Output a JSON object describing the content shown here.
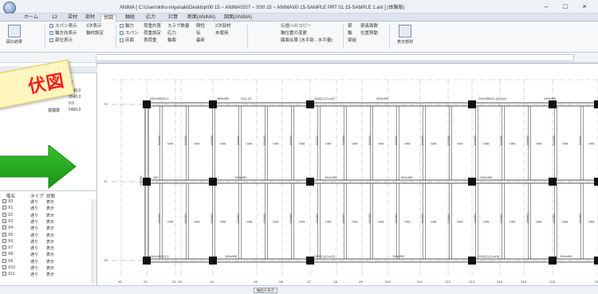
{
  "window": {
    "title": "ANIMA [ C:\\Users\\kiho-miyanaki\\Desktop\\00 15 ~ ANIMA\\SS7 ~ SS0 15 ~ ANIMA\\00 15-SAMPLE PRT 01 15-SAMPLE 1.anl ] (体験版)",
    "minimize": "–",
    "maximize": "□",
    "close": "×"
  },
  "menu_tabs": [
    {
      "label": "ホーム"
    },
    {
      "label": "13"
    },
    {
      "label": "梁材"
    },
    {
      "label": "部材"
    },
    {
      "label": "伏図"
    },
    {
      "label": "軸組"
    },
    {
      "label": "応力"
    },
    {
      "label": "計算"
    },
    {
      "label": "断面(ANIMA)"
    },
    {
      "label": "図面(ANIMA)"
    }
  ],
  "ribbon": {
    "group1_button": "図の結果",
    "col1": [
      "スパン表示",
      "軸方向表示",
      "部位表示"
    ],
    "col2": [
      "2次表示",
      "軸材設定"
    ],
    "col3": [
      "軸力",
      "スパン",
      "床面"
    ],
    "col4": [
      "荷重計算",
      "荷重設定",
      "実荷重"
    ],
    "col5": [
      "スラブ数量",
      "応力",
      "軸面"
    ],
    "col6": [
      "剛性",
      "伝",
      "最新"
    ],
    "col7": [
      "2次部材",
      "未使用",
      ""
    ],
    "col8": [
      "伝播へのコピー",
      "軸位置の変更",
      "図面合算 (水平部 - 水平量)"
    ],
    "col9": [
      "梁",
      "軸",
      "梁組"
    ],
    "col10": [
      "梁長面数",
      "位置移動",
      ""
    ],
    "big_button2": "表示部材"
  },
  "left_panel": {
    "rows": [
      {
        "text": "1F"
      },
      {
        "text": "6540.0"
      },
      {
        "text": "5540.0"
      },
      {
        "text": "0.0"
      },
      {
        "text": "基礎層"
      },
      {
        "text": "5400.0"
      }
    ],
    "columns": [
      "階名",
      "タイプ",
      "状態"
    ],
    "list": [
      {
        "name": "X0",
        "type": "通り",
        "state": "表示"
      },
      {
        "name": "X1",
        "type": "通り",
        "state": "表示"
      },
      {
        "name": "X2",
        "type": "通り",
        "state": "表示"
      },
      {
        "name": "X3",
        "type": "通り",
        "state": "表示"
      },
      {
        "name": "X4",
        "type": "通り",
        "state": "表示"
      },
      {
        "name": "X5",
        "type": "通り",
        "state": "表示"
      },
      {
        "name": "X6",
        "type": "通り",
        "state": "表示"
      },
      {
        "name": "X7",
        "type": "通り",
        "state": "表示"
      },
      {
        "name": "X8",
        "type": "通り",
        "state": "表示"
      },
      {
        "name": "X9",
        "type": "通り",
        "state": "表示"
      },
      {
        "name": "X10",
        "type": "通り",
        "state": "表示"
      },
      {
        "name": "X11",
        "type": "通り",
        "state": "表示"
      }
    ]
  },
  "stamp": {
    "text": "伏図"
  },
  "plan": {
    "y_axis": [
      {
        "label": "Y2"
      },
      {
        "label": "Y1"
      },
      {
        "label": "Y0"
      }
    ],
    "x_axis": [
      {
        "label": "X0"
      },
      {
        "label": "X1"
      },
      {
        "label": "X2"
      },
      {
        "label": "X3"
      },
      {
        "label": "X4"
      },
      {
        "label": "X5"
      },
      {
        "label": "X6"
      },
      {
        "label": "X7"
      },
      {
        "label": "X8"
      },
      {
        "label": "X9"
      },
      {
        "label": "X10"
      },
      {
        "label": "X11"
      },
      {
        "label": "X12"
      },
      {
        "label": "X13"
      },
      {
        "label": "X14"
      },
      {
        "label": "X15"
      },
      {
        "label": "X16"
      },
      {
        "label": "X17"
      }
    ],
    "top_girders": [
      "240x450(2)-1",
      "380x450",
      "2(1)-(2)",
      "240(2)-(2)-n(2)",
      "240x450",
      "240x450(2)-(2)-n(4)",
      "240x450"
    ],
    "bottom_girders": [
      "240x450(2)-1",
      "150x450",
      "240(2)-(2)-n(2)",
      "150x450",
      "240(2)-(2)-n(4)",
      "150x450"
    ],
    "mid_girders": [
      "150",
      "150x450",
      "150x450",
      "150x450",
      "150x450"
    ],
    "left_beam_label": "150x450",
    "bay_label": "GH8",
    "joist_label": "120x300"
  },
  "status": {
    "tab": "軸組の表示"
  }
}
